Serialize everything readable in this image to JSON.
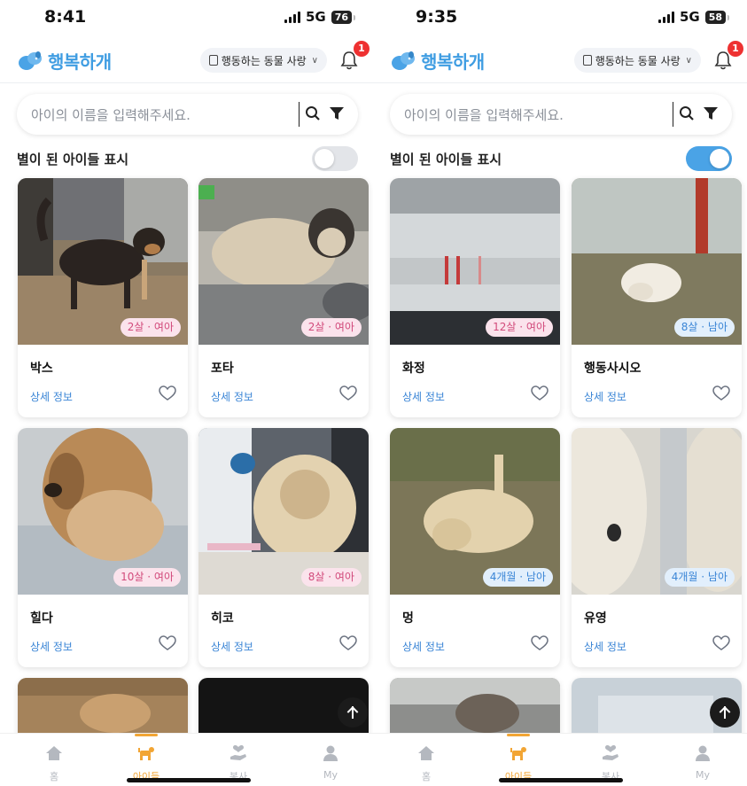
{
  "screens": [
    {
      "status": {
        "time": "8:41",
        "network": "5G",
        "battery": "76"
      },
      "header": {
        "app_title": "행복하개",
        "shelter": "행동하는 동물 사랑",
        "notification_count": "1"
      },
      "search": {
        "placeholder": "아이의 이름을 입력해주세요."
      },
      "stars_label": "별이 된 아이들 표시",
      "stars_toggle_on": false,
      "pets": [
        {
          "name": "박스",
          "age": "2살 · 여아",
          "sex": "female",
          "detail": "상세 정보"
        },
        {
          "name": "포타",
          "age": "2살 · 여아",
          "sex": "female",
          "detail": "상세 정보"
        },
        {
          "name": "힐다",
          "age": "10살 · 여아",
          "sex": "female",
          "detail": "상세 정보"
        },
        {
          "name": "히코",
          "age": "8살 · 여아",
          "sex": "female",
          "detail": "상세 정보"
        }
      ],
      "tabs": [
        {
          "label": "홈",
          "icon": "home-icon"
        },
        {
          "label": "아이들",
          "icon": "dog-icon"
        },
        {
          "label": "봉사",
          "icon": "volunteer-icon"
        },
        {
          "label": "My",
          "icon": "user-icon"
        }
      ]
    },
    {
      "status": {
        "time": "9:35",
        "network": "5G",
        "battery": "58"
      },
      "header": {
        "app_title": "행복하개",
        "shelter": "행동하는 동물 사랑",
        "notification_count": "1"
      },
      "search": {
        "placeholder": "아이의 이름을 입력해주세요."
      },
      "stars_label": "별이 된 아이들 표시",
      "stars_toggle_on": true,
      "pets": [
        {
          "name": "화정",
          "age": "12살 · 여아",
          "sex": "female",
          "detail": "상세 정보"
        },
        {
          "name": "행동사시오",
          "age": "8살 · 남아",
          "sex": "male",
          "detail": "상세 정보"
        },
        {
          "name": "멍",
          "age": "4개월 · 남아",
          "sex": "male",
          "detail": "상세 정보"
        },
        {
          "name": "유영",
          "age": "4개월 · 남아",
          "sex": "male",
          "detail": "상세 정보"
        }
      ],
      "tabs": [
        {
          "label": "홈",
          "icon": "home-icon"
        },
        {
          "label": "아이들",
          "icon": "dog-icon"
        },
        {
          "label": "봉사",
          "icon": "volunteer-icon"
        },
        {
          "label": "My",
          "icon": "user-icon"
        }
      ]
    }
  ],
  "colors": {
    "brand_blue": "#3f9de2",
    "accent_orange": "#f2a534",
    "female_badge": "#d24a7b",
    "male_badge": "#3a85d6",
    "notification_red": "#ee3131"
  }
}
